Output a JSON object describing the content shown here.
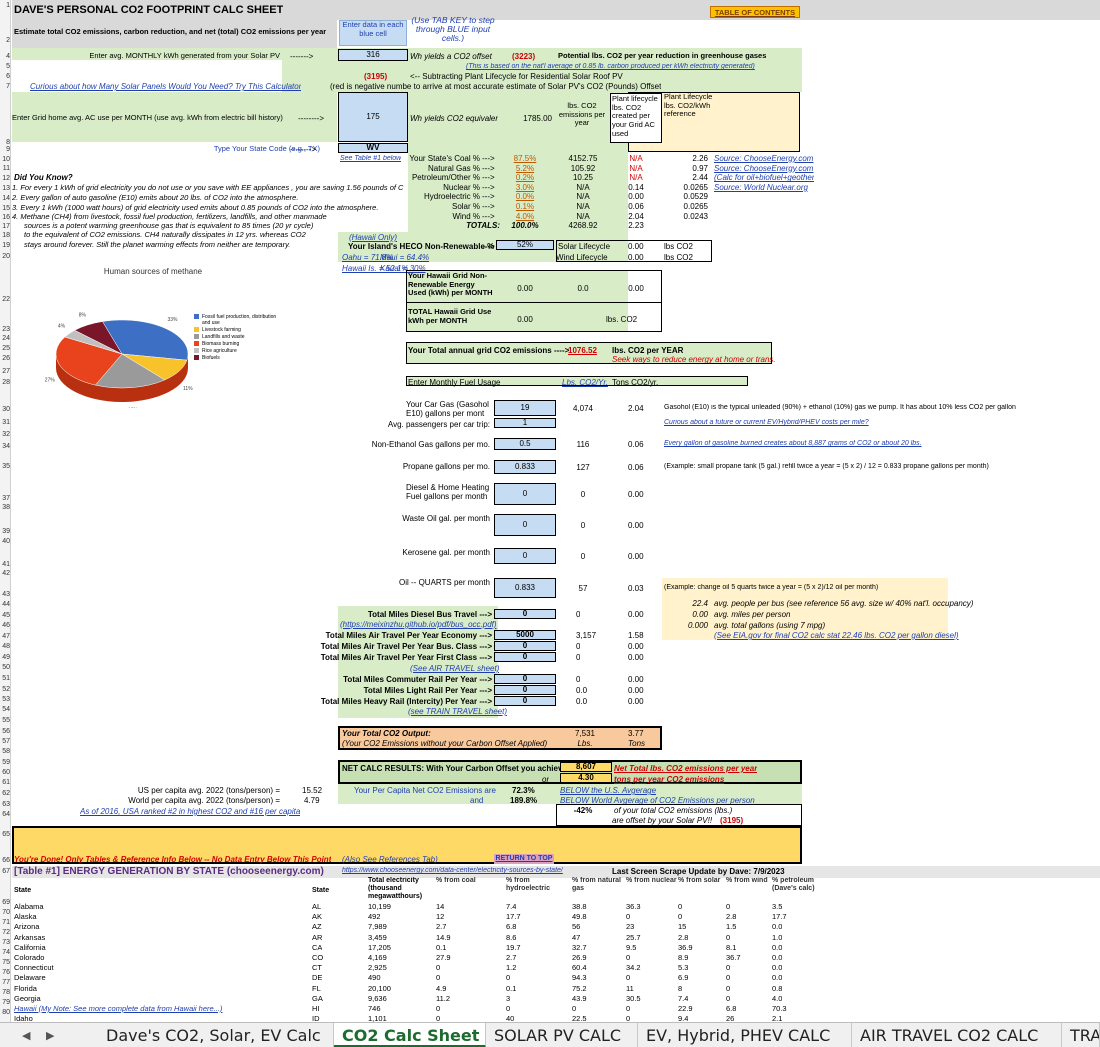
{
  "title": "DAVE'S PERSONAL CO2 FOOTPRINT CALC SHEET",
  "subtitle": "Estimate total CO2 emissions, carbon reduction, and net (total) CO2 emissions per year",
  "toc_button": "TABLE OF CONTENTS",
  "blue_hint": "Enter data in each blue cell",
  "tab_hint": "(Use TAB KEY to step through BLUE input cells.)",
  "solar": {
    "label": "Enter avg. MONTHLY kWh generated from your Solar PV",
    "arrow": "------->",
    "value": "316",
    "yields": "Wh yields a CO2 offset",
    "offset_value": "(3223)",
    "potential": "Potential lbs. CO2 per year reduction in greenhouse gases",
    "based_on": "(This is based on the nat'l average of 0.85 lb. carbon produced per kWh electricity generated)",
    "lifecycle_value": "(3195)",
    "lifecycle_text": "<-- Subtracting Plant Lifecycle for Residential Solar Roof PV",
    "red_note": "(red is negative numbe to arrive at most accurate estimate of Solar PV's CO2 (Pounds) Offset",
    "panels_link": "Curious about how Many Solar Panels Would You Need? Try This Calculator"
  },
  "grid": {
    "label": "Enter Grid home avg. AC use per MONTH (use avg. kWh from electric bill history)",
    "arrow": "-------->",
    "value": "175",
    "yields": "Wh yields CO2 equivalent o",
    "equiv": "1785.00",
    "col_lbs": "lbs. CO2 emissions per year",
    "col_plant": "Plant lifecycle lbs. CO2 created per your Grid AC used",
    "col_ref": "Plant Lifecycle lbs. CO2/kWh reference",
    "state_label": "Type Your State Code (e.g., TX)",
    "state_arrow": "-------->",
    "state_value": "WV",
    "see_table": "See Table #1 below"
  },
  "sources": [
    {
      "name": "Your State's Coal %",
      "pct": "87.5%",
      "lbs": "4152.75",
      "plant": "N/A",
      "ref": "2.26",
      "src": "Source: ChooseEnergy.com"
    },
    {
      "name": "Natural Gas %",
      "pct": "5.2%",
      "lbs": "105.92",
      "plant": "N/A",
      "ref": "0.97",
      "src": "Source: ChooseEnergy.com"
    },
    {
      "name": "Petroleum/Other %",
      "pct": "0.2%",
      "lbs": "10.25",
      "plant": "N/A",
      "ref": "2.44",
      "src": "(Calc for oil+biofuel+geothermal)"
    },
    {
      "name": "Nuclear %",
      "pct": "3.0%",
      "lbs": "N/A",
      "plant": "0.14",
      "ref": "0.0265",
      "src": "Source: World Nuclear.org"
    },
    {
      "name": "Hydroelectric %",
      "pct": "0.0%",
      "lbs": "N/A",
      "plant": "0.00",
      "ref": "0.0529",
      "src": ""
    },
    {
      "name": "Solar %",
      "pct": "0.1%",
      "lbs": "N/A",
      "plant": "0.06",
      "ref": "0.0265",
      "src": ""
    },
    {
      "name": "Wind %",
      "pct": "4.0%",
      "lbs": "N/A",
      "plant": "2.04",
      "ref": "0.0243",
      "src": ""
    }
  ],
  "totals": {
    "label": "TOTALS:",
    "pct": "100.0%",
    "lbs": "4268.92",
    "plant": "2.23"
  },
  "sources_arrow": "--->",
  "did_you_know": {
    "heading": "Did You Know?",
    "l1": "1.  For every  1 kWh of grid electricity you do not use or you  save with EE appliances ,  you are saving 1.56 pounds  of C",
    "l2": "2.  Every gallon of auto gasoline  (E10) emits about  20 lbs.  of CO2 into the atmosphere.",
    "l3": "3.  Every  1 kWh  (1000 watt hours) of grid electricity used emits  about 0.85 pounds of CO2  into the atmosphere.",
    "l4": "4.  Methane (CH4)  from livestock, fossil fuel production, fertilizers, landfills, and other manmade",
    "l5": "sources is a potent warming greenhouse gas that is equivalent to  85 times (20 yr cycle)",
    "l6": "to the equivalent of CO2 emissions. CH4 naturally dissipates in 12 yrs. whereas CO2",
    "l7": "stays around forever. Still the planet warming effects from neither are temporary."
  },
  "hawaii": {
    "only": "(Hawaii Only)",
    "heco": "Your Island's HECO Non-Renewable %",
    "heco_arrow": "--->",
    "heco_value": "52%",
    "oahu": "Oahu = 71.8%",
    "maui": "Maui = 64.4%",
    "hawaii_is": "Hawaii Is. = 52.1%",
    "kauai": "Kauai = 30%",
    "solar_life": "Solar Lifecycle",
    "wind_life": "Wind Lifecycle",
    "solar_life_val": "0.00",
    "wind_life_val": "0.00",
    "lbs": "lbs CO2",
    "nonrenew": "Your Hawaii Grid Non-Renewable Energy Used (kWh) per MONTH",
    "nonrenew_val": "0.00",
    "nonrenew_val2": "0.0",
    "nonrenew_val3": "0.00",
    "total_use": "TOTAL Hawaii Grid Use kWh per MONTH",
    "total_use_val": "0.00",
    "total_use_unit": "lbs. CO2"
  },
  "annual": {
    "label": "Your Total annual grid CO2 emissions ---->",
    "value": "1076.52",
    "unit": "lbs. CO2 per YEAR",
    "advice": "Seek ways to reduce energy at home or trans."
  },
  "fuel_header": {
    "label": "Enter Monthly Fuel Usage",
    "col1": "Lbs. CO2/Yr.",
    "col2": "Tons CO2/yr."
  },
  "fuels": [
    {
      "label": "Your Car Gas (Gasohol E10) gallons per mont",
      "val": "19",
      "lbs": "4,074",
      "tons": "2.04",
      "note": "Gasohol (E10) is the typical unleaded  (90%) + ethanol (10%) gas we pump. It has about 10% less CO2 per gallon"
    },
    {
      "label": "Avg. passengers per car trip:",
      "val": "1",
      "lbs": "",
      "tons": "",
      "note": "Curious about a future or current EV/Hybrid/PHEV costs per mile?"
    },
    {
      "label": "Non-Ethanol Gas gallons per mo.",
      "val": "0.5",
      "lbs": "116",
      "tons": "0.06",
      "note": "Every gallon of gasoline burned creates about 8,887 grams of CO2 or about 20 lbs."
    },
    {
      "label": "Propane gallons per mo.",
      "val": "0.833",
      "lbs": "127",
      "tons": "0.06",
      "note": "(Example: small propane tank (5 gal.) refill twice a year = (5 x 2) / 12 = 0.833 propane gallons per month)"
    },
    {
      "label": "Diesel & Home Heating Fuel gallons per month",
      "val": "0",
      "lbs": "0",
      "tons": "0.00",
      "note": ""
    },
    {
      "label": "Waste Oil gal. per month",
      "val": "0",
      "lbs": "0",
      "tons": "0.00",
      "note": ""
    },
    {
      "label": "Kerosene gal. per month",
      "val": "0",
      "lbs": "0",
      "tons": "0.00",
      "note": ""
    },
    {
      "label": "Oil -- QUARTS per month",
      "val": "0.833",
      "lbs": "57",
      "tons": "0.03",
      "note": "(Example: change oil 5 quarts twice a year = (5 x 2)/12 oil per month)"
    }
  ],
  "bus_notes": [
    {
      "v": "22.4",
      "t": "avg. people per bus (see reference 56 avg. size w/ 40% nat'l. occupancy)"
    },
    {
      "v": "0.00",
      "t": "avg. miles per person"
    },
    {
      "v": "0.000",
      "t": "avg. total gallons (using 7 mpg)"
    }
  ],
  "eia_link": "(See EIA.gov for final CO2 calc stat 22.46 lbs. CO2 per gallon diesel)",
  "travel": [
    {
      "label": "Total Miles Diesel Bus Travel --->",
      "val": "0",
      "lbs": "0",
      "tons": "0.00"
    },
    {
      "label": "Total Miles Air Travel Per Year Economy --->",
      "val": "5000",
      "lbs": "3,157",
      "tons": "1.58"
    },
    {
      "label": "Total Miles Air Travel Per Year Bus. Class --->",
      "val": "0",
      "lbs": "0",
      "tons": "0.00"
    },
    {
      "label": "Total Miles Air Travel Per Year First Class --->",
      "val": "0",
      "lbs": "0",
      "tons": "0.00"
    },
    {
      "label": "Total Miles Commuter Rail Per Year --->",
      "val": "0",
      "lbs": "0",
      "tons": "0.00"
    },
    {
      "label": "Total Miles Light Rail Per Year --->",
      "val": "0",
      "lbs": "0.0",
      "tons": "0.00"
    },
    {
      "label": "Total Miles Heavy Rail (Intercity) Per Year --->",
      "val": "0",
      "lbs": "0.0",
      "tons": "0.00"
    }
  ],
  "bus_link": "(https://meixinzhu.github.io/pdf/bus_occ.pdf)",
  "air_link": "(See AIR TRAVEL sheet)",
  "train_link": "(see TRAIN TRAVEL sheet)",
  "total_output": {
    "label": "Your Total CO2 Output:",
    "sub": "(Your CO2 Emissions without your Carbon Offset Applied)",
    "lbs": "7,531",
    "tons": "3.77",
    "lbs_unit": "Lbs.",
    "tons_unit": "Tons"
  },
  "net": {
    "label": "NET CALC RESULTS: With Your Carbon Offset you achieve ---->",
    "or": "or",
    "lbs": "8,607",
    "lbs_text": "Net Total lbs. CO2 emissions per year",
    "tons": "4.30",
    "tons_text": "tons per year CO2 emissions",
    "us_avg": "US per capita avg. 2022 (tons/person) =",
    "us_val": "15.52",
    "world_avg": "World per capita avg. 2022 (tons/person) =",
    "world_val": "4.79",
    "rank_link": "As of 2016, USA ranked #2 in highest CO2 and #16 per capita",
    "per_capita": "Your Per Capita Net CO2 Emissions are",
    "and": "and",
    "pct_us": "72.3%",
    "pct_world": "189.8%",
    "below_us": "BELOW the U.S. Avgerage",
    "below_world": "BELOW World Avgerage of CO2 Emissions per person",
    "offset_pct": "-42%",
    "offset_text1": "of your total CO2 emissions (lbs.)",
    "offset_text2": "are offset by your Solar PV!!",
    "offset_val": "(3195)"
  },
  "done": {
    "text": "You're Done! Only Tables & Reference Info Below  -- No Data Entry Below This Point",
    "refs": "(Also See References Tab)",
    "return_top": "RETURN TO TOP"
  },
  "table1": {
    "title": "[Table #1] ENERGY GENERATION BY STATE  (chooseenergy.com)",
    "url": "https://www.chooseenergy.com/data-center/electricity-sources-by-state/",
    "updated": "Last Screen Scrape Update by Dave: 7/9/2023",
    "headers": [
      "State",
      "State",
      "Total electricity (thousand megawatthours)",
      "% from coal",
      "% from hydroelectric",
      "% from natural gas",
      "% from nuclear",
      "% from solar",
      "% from wind",
      "% petroleum (Dave's calc)"
    ],
    "rows": [
      [
        "Alabama",
        "AL",
        "10,199",
        "14",
        "7.4",
        "38.8",
        "36.3",
        "0",
        "0",
        "3.5"
      ],
      [
        "Alaska",
        "AK",
        "492",
        "12",
        "17.7",
        "49.8",
        "0",
        "0",
        "2.8",
        "17.7"
      ],
      [
        "Arizona",
        "AZ",
        "7,989",
        "2.7",
        "6.8",
        "56",
        "23",
        "15",
        "1.5",
        "0.0"
      ],
      [
        "Arkansas",
        "AR",
        "3,459",
        "14.9",
        "8.6",
        "47",
        "25.7",
        "2.8",
        "0",
        "1.0"
      ],
      [
        "California",
        "CA",
        "17,205",
        "0.1",
        "19.7",
        "32.7",
        "9.5",
        "36.9",
        "8.1",
        "0.0"
      ],
      [
        "Colorado",
        "CO",
        "4,169",
        "27.9",
        "2.7",
        "26.9",
        "0",
        "8.9",
        "36.7",
        "0.0"
      ],
      [
        "Connecticut",
        "CT",
        "2,925",
        "0",
        "1.2",
        "60.4",
        "34.2",
        "5.3",
        "0",
        "0.0"
      ],
      [
        "Delaware",
        "DE",
        "490",
        "0",
        "0",
        "94.3",
        "0",
        "6.9",
        "0",
        "0.0"
      ],
      [
        "Florida",
        "FL",
        "20,100",
        "4.9",
        "0.1",
        "75.2",
        "11",
        "8",
        "0",
        "0.8"
      ],
      [
        "Georgia",
        "GA",
        "9,636",
        "11.2",
        "3",
        "43.9",
        "30.5",
        "7.4",
        "0",
        "4.0"
      ],
      [
        "Hawaii  (My Note: See more complete data from Hawaii here...)",
        "HI",
        "746",
        "0",
        "0",
        "0",
        "0",
        "22.9",
        "6.8",
        "70.3"
      ],
      [
        "Idaho",
        "ID",
        "1,101",
        "0",
        "40",
        "22.5",
        "0",
        "9.4",
        "26",
        "2.1"
      ]
    ]
  },
  "chart": {
    "title": "Human sources of methane",
    "legend": [
      "Fossil fuel production, distribution and use",
      "Livestock farming",
      "Landfills and waste",
      "Biomass burning",
      "Rice agriculture",
      "Biofuels"
    ],
    "slice_labels": [
      "33%",
      "11%",
      "18%",
      "27%",
      "4%",
      "8%"
    ]
  },
  "colors": {
    "green": "#d8ecc8",
    "blue_input": "#c6dcf2",
    "yellow": "#fff2cc",
    "orange": "#f8c99c",
    "gold": "#ffd966",
    "lime": "#c6e0b4"
  },
  "tabs": [
    "Dave's CO2, Solar, EV Calc",
    "CO2 Calc Sheet",
    "SOLAR PV CALC",
    "EV, Hybrid, PHEV CALC",
    "AIR TRAVEL CO2 CALC",
    "TRA"
  ]
}
